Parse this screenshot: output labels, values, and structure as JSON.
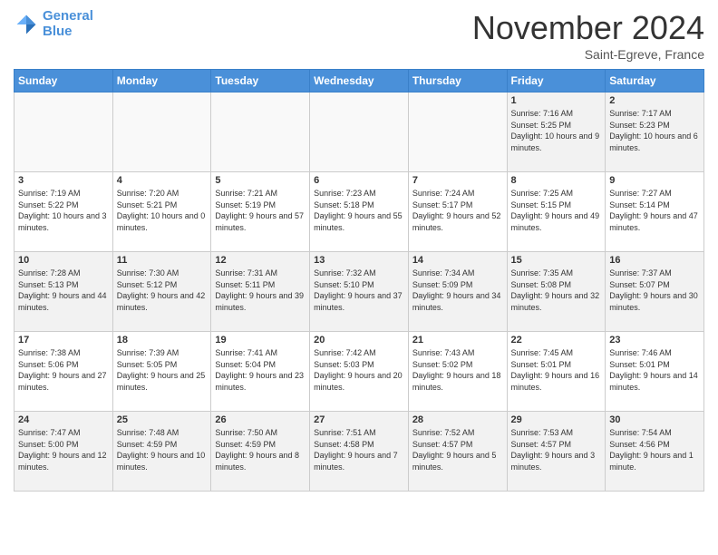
{
  "header": {
    "logo_line1": "General",
    "logo_line2": "Blue",
    "month": "November 2024",
    "location": "Saint-Egreve, France"
  },
  "weekdays": [
    "Sunday",
    "Monday",
    "Tuesday",
    "Wednesday",
    "Thursday",
    "Friday",
    "Saturday"
  ],
  "weeks": [
    [
      {
        "day": "",
        "info": ""
      },
      {
        "day": "",
        "info": ""
      },
      {
        "day": "",
        "info": ""
      },
      {
        "day": "",
        "info": ""
      },
      {
        "day": "",
        "info": ""
      },
      {
        "day": "1",
        "info": "Sunrise: 7:16 AM\nSunset: 5:25 PM\nDaylight: 10 hours\nand 9 minutes."
      },
      {
        "day": "2",
        "info": "Sunrise: 7:17 AM\nSunset: 5:23 PM\nDaylight: 10 hours\nand 6 minutes."
      }
    ],
    [
      {
        "day": "3",
        "info": "Sunrise: 7:19 AM\nSunset: 5:22 PM\nDaylight: 10 hours\nand 3 minutes."
      },
      {
        "day": "4",
        "info": "Sunrise: 7:20 AM\nSunset: 5:21 PM\nDaylight: 10 hours\nand 0 minutes."
      },
      {
        "day": "5",
        "info": "Sunrise: 7:21 AM\nSunset: 5:19 PM\nDaylight: 9 hours\nand 57 minutes."
      },
      {
        "day": "6",
        "info": "Sunrise: 7:23 AM\nSunset: 5:18 PM\nDaylight: 9 hours\nand 55 minutes."
      },
      {
        "day": "7",
        "info": "Sunrise: 7:24 AM\nSunset: 5:17 PM\nDaylight: 9 hours\nand 52 minutes."
      },
      {
        "day": "8",
        "info": "Sunrise: 7:25 AM\nSunset: 5:15 PM\nDaylight: 9 hours\nand 49 minutes."
      },
      {
        "day": "9",
        "info": "Sunrise: 7:27 AM\nSunset: 5:14 PM\nDaylight: 9 hours\nand 47 minutes."
      }
    ],
    [
      {
        "day": "10",
        "info": "Sunrise: 7:28 AM\nSunset: 5:13 PM\nDaylight: 9 hours\nand 44 minutes."
      },
      {
        "day": "11",
        "info": "Sunrise: 7:30 AM\nSunset: 5:12 PM\nDaylight: 9 hours\nand 42 minutes."
      },
      {
        "day": "12",
        "info": "Sunrise: 7:31 AM\nSunset: 5:11 PM\nDaylight: 9 hours\nand 39 minutes."
      },
      {
        "day": "13",
        "info": "Sunrise: 7:32 AM\nSunset: 5:10 PM\nDaylight: 9 hours\nand 37 minutes."
      },
      {
        "day": "14",
        "info": "Sunrise: 7:34 AM\nSunset: 5:09 PM\nDaylight: 9 hours\nand 34 minutes."
      },
      {
        "day": "15",
        "info": "Sunrise: 7:35 AM\nSunset: 5:08 PM\nDaylight: 9 hours\nand 32 minutes."
      },
      {
        "day": "16",
        "info": "Sunrise: 7:37 AM\nSunset: 5:07 PM\nDaylight: 9 hours\nand 30 minutes."
      }
    ],
    [
      {
        "day": "17",
        "info": "Sunrise: 7:38 AM\nSunset: 5:06 PM\nDaylight: 9 hours\nand 27 minutes."
      },
      {
        "day": "18",
        "info": "Sunrise: 7:39 AM\nSunset: 5:05 PM\nDaylight: 9 hours\nand 25 minutes."
      },
      {
        "day": "19",
        "info": "Sunrise: 7:41 AM\nSunset: 5:04 PM\nDaylight: 9 hours\nand 23 minutes."
      },
      {
        "day": "20",
        "info": "Sunrise: 7:42 AM\nSunset: 5:03 PM\nDaylight: 9 hours\nand 20 minutes."
      },
      {
        "day": "21",
        "info": "Sunrise: 7:43 AM\nSunset: 5:02 PM\nDaylight: 9 hours\nand 18 minutes."
      },
      {
        "day": "22",
        "info": "Sunrise: 7:45 AM\nSunset: 5:01 PM\nDaylight: 9 hours\nand 16 minutes."
      },
      {
        "day": "23",
        "info": "Sunrise: 7:46 AM\nSunset: 5:01 PM\nDaylight: 9 hours\nand 14 minutes."
      }
    ],
    [
      {
        "day": "24",
        "info": "Sunrise: 7:47 AM\nSunset: 5:00 PM\nDaylight: 9 hours\nand 12 minutes."
      },
      {
        "day": "25",
        "info": "Sunrise: 7:48 AM\nSunset: 4:59 PM\nDaylight: 9 hours\nand 10 minutes."
      },
      {
        "day": "26",
        "info": "Sunrise: 7:50 AM\nSunset: 4:59 PM\nDaylight: 9 hours\nand 8 minutes."
      },
      {
        "day": "27",
        "info": "Sunrise: 7:51 AM\nSunset: 4:58 PM\nDaylight: 9 hours\nand 7 minutes."
      },
      {
        "day": "28",
        "info": "Sunrise: 7:52 AM\nSunset: 4:57 PM\nDaylight: 9 hours\nand 5 minutes."
      },
      {
        "day": "29",
        "info": "Sunrise: 7:53 AM\nSunset: 4:57 PM\nDaylight: 9 hours\nand 3 minutes."
      },
      {
        "day": "30",
        "info": "Sunrise: 7:54 AM\nSunset: 4:56 PM\nDaylight: 9 hours\nand 1 minute."
      }
    ]
  ]
}
